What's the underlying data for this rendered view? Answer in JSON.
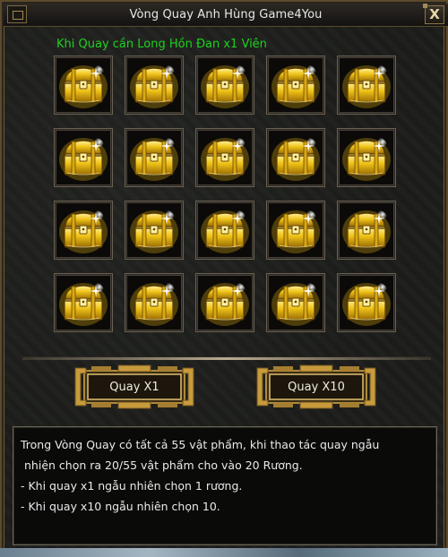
{
  "window": {
    "title": "Vòng Quay Anh Hùng Game4You",
    "close_label": "X"
  },
  "hint": {
    "text": "Khi Quay cần Long Hồn Đan x1 Viên",
    "color": "#1ed21e"
  },
  "grid": {
    "rows": 4,
    "columns": 5,
    "item_icon": "golden-treasure-chest-icon",
    "item_count": 20
  },
  "buttons": {
    "spin_x1_label": "Quay X1",
    "spin_x10_label": "Quay X10"
  },
  "description": {
    "line1": "Trong Vòng Quay có tất cả 55 vật phẩm, khi thao tác quay ngẫu",
    "line2": "nhiện chọn ra 20/55 vật phẩm cho vào 20 Rương.",
    "line3": "- Khi quay x1 ngẫu nhiên chọn 1 rương.",
    "line4": "- Khi quay x10 ngẫu nhiên chọn 10."
  },
  "colors": {
    "panel_bg": "#1c1d1a",
    "gold": "#e8c020",
    "border": "#6d5a37"
  }
}
